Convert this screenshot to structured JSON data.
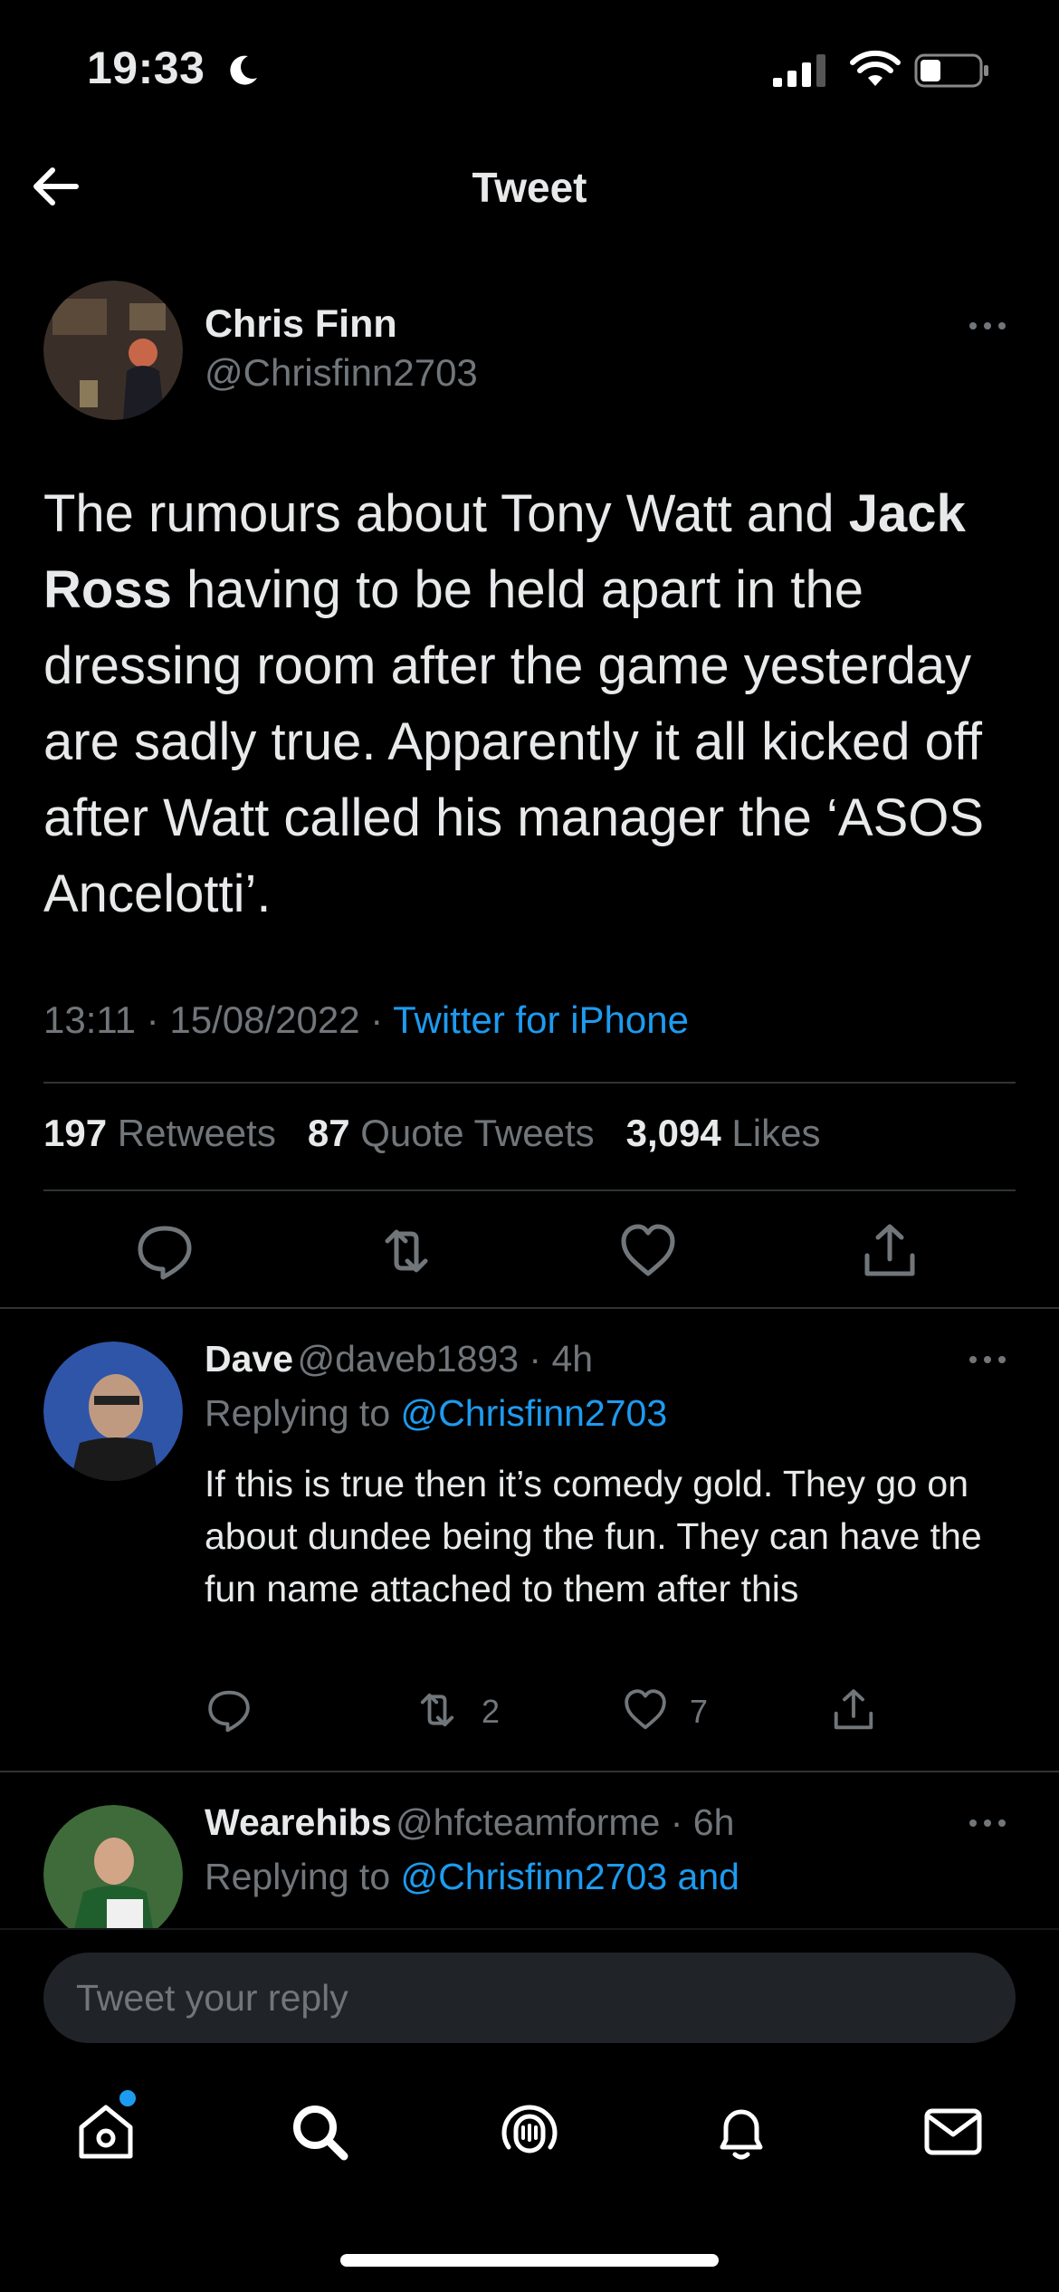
{
  "status_bar": {
    "time": "19:33"
  },
  "header": {
    "title": "Tweet"
  },
  "tweet": {
    "author_name": "Chris Finn",
    "author_handle": "@Chrisfinn2703",
    "text_before": "The rumours about Tony Watt and ",
    "text_bold": "Jack Ross",
    "text_after": " having to be held apart in the dressing room after the game yesterday are sadly true. Apparently it all kicked off after Watt called his manager the ‘ASOS Ancelotti’.",
    "time": "13:11",
    "date": "15/08/2022",
    "source": "Twitter for iPhone",
    "separator": "·",
    "retweets_count": "197",
    "retweets_label": "Retweets",
    "quotes_count": "87",
    "quotes_label": "Quote Tweets",
    "likes_count": "3,094",
    "likes_label": "Likes"
  },
  "replies": [
    {
      "name": "Dave",
      "handle": "@daveb1893",
      "time": "4h",
      "replying_prefix": "Replying to",
      "replying_to": "@Chrisfinn2703",
      "text": "If this is true then it’s comedy gold. They go on about dundee being the fun. They can have the fun name attached to them after this",
      "retweets": "2",
      "likes": "7"
    },
    {
      "name": "Wearehibs",
      "handle": "@hfcteamforme",
      "time": "6h",
      "replying_prefix": "Replying to",
      "replying_to": "@Chrisfinn2703 and"
    }
  ],
  "reply_box": {
    "placeholder": "Tweet your reply"
  },
  "icons": {
    "accent": "#1d9bf0",
    "background": "#000000",
    "muted": "#71767b"
  }
}
